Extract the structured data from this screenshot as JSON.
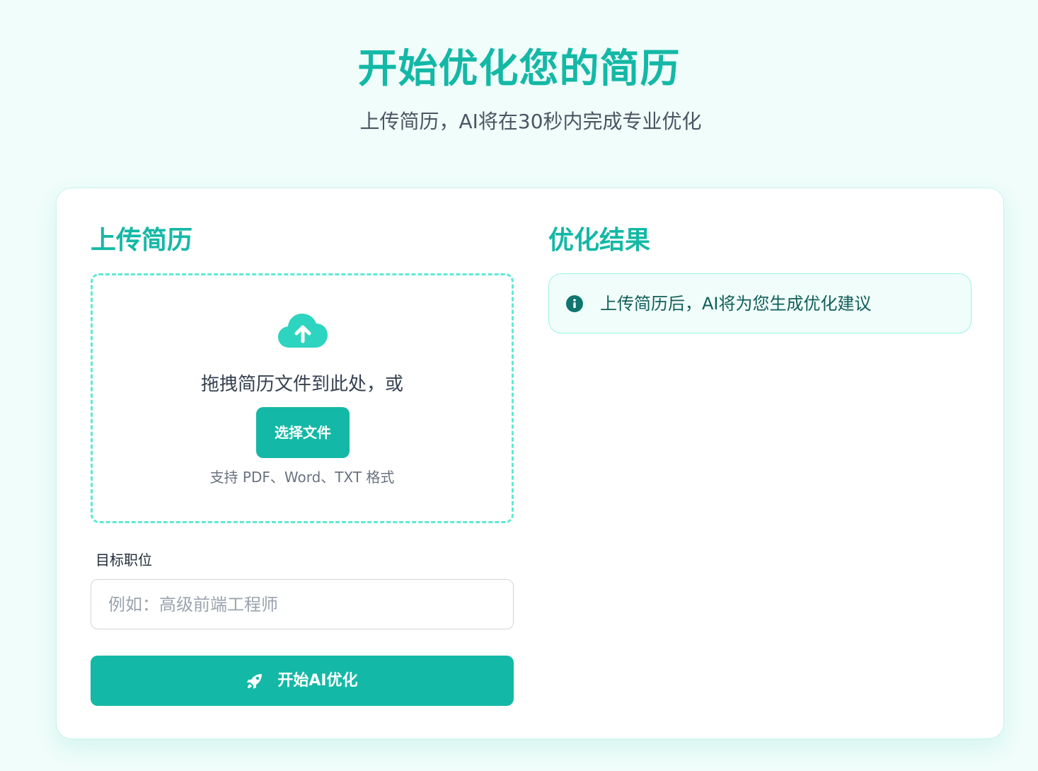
{
  "hero": {
    "title": "开始优化您的简历",
    "subtitle": "上传简历，AI将在30秒内完成专业优化"
  },
  "upload": {
    "title": "上传简历",
    "drop_text": "拖拽简历文件到此处，或",
    "choose_button": "选择文件",
    "formats": "支持 PDF、Word、TXT 格式",
    "icon": "cloud-upload-icon"
  },
  "target": {
    "label": "目标职位",
    "placeholder": "例如：高级前端工程师",
    "value": ""
  },
  "action": {
    "start_label": "开始AI优化",
    "icon": "rocket-icon"
  },
  "result": {
    "title": "优化结果",
    "info_text": "上传简历后，AI将为您生成优化建议",
    "icon": "info-icon"
  },
  "colors": {
    "accent": "#14b8a6",
    "background": "#f0fdfa",
    "dashed_border": "#5eead4",
    "info_icon": "#0f766e"
  }
}
